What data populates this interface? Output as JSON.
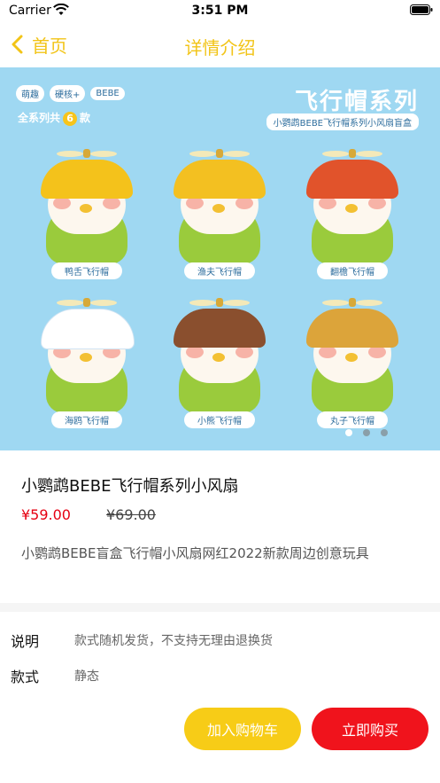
{
  "status_bar": {
    "carrier": "Carrier",
    "time": "3:51 PM"
  },
  "nav": {
    "back_label": "首页",
    "title": "详情介绍"
  },
  "banner": {
    "brand": [
      "萌趣",
      "硬核+",
      "BEBE"
    ],
    "series_count_prefix": "全系列共",
    "series_count": "6",
    "series_count_suffix": "款",
    "series_title": "飞行帽系列",
    "series_subtitle": "小鹦鹉BEBE飞行帽系列小风扇盲盒",
    "figures": [
      {
        "label": "鸭舌飞行帽",
        "hat_color": "#f4c21b"
      },
      {
        "label": "渔夫飞行帽",
        "hat_color": "#f3c021"
      },
      {
        "label": "翻檐飞行帽",
        "hat_color": "#e1532b"
      },
      {
        "label": "海鸥飞行帽",
        "hat_color": "#ffffff"
      },
      {
        "label": "小熊飞行帽",
        "hat_color": "#8a4f2e"
      },
      {
        "label": "丸子飞行帽",
        "hat_color": "#dca43a"
      }
    ],
    "page_count": 3,
    "active_page": 1
  },
  "product": {
    "title": "小鹦鹉BEBE飞行帽系列小风扇",
    "price": "¥59.00",
    "original_price": "¥69.00",
    "description": "小鹦鹉BEBE盲盒飞行帽小风扇网红2022新款周边创意玩具"
  },
  "specs": [
    {
      "key": "说明",
      "value": "款式随机发货，不支持无理由退换货"
    },
    {
      "key": "款式",
      "value": "静态"
    }
  ],
  "actions": {
    "add_cart": "加入购物车",
    "buy_now": "立即购买"
  },
  "colors": {
    "accent_yellow": "#f2c417",
    "price_red": "#e60012",
    "buy_red": "#f0131c",
    "cart_yellow": "#f7cc17",
    "banner_blue": "#9fd8f2"
  }
}
